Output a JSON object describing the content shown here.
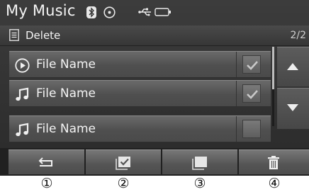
{
  "header": {
    "title": "My Music",
    "icons": [
      "bluetooth-icon",
      "disc-icon",
      "usb-icon",
      "ipod-icon"
    ]
  },
  "subheader": {
    "menu_icon": "list-menu-icon",
    "label": "Delete",
    "page_indicator": "2/2"
  },
  "list": {
    "items": [
      {
        "name": "File Name",
        "icon": "play-circle-icon",
        "checked": true
      },
      {
        "name": "File Name",
        "icon": "music-note-icon",
        "checked": true
      },
      {
        "name": "File Name",
        "icon": "music-note-icon",
        "checked": false
      }
    ]
  },
  "scroll": {
    "up_icon": "triangle-up-icon",
    "down_icon": "triangle-down-icon"
  },
  "bottom_bar": {
    "buttons": [
      {
        "icon": "back-arrow-icon"
      },
      {
        "icon": "select-all-icon"
      },
      {
        "icon": "deselect-all-icon"
      },
      {
        "icon": "trash-icon"
      }
    ]
  },
  "callouts": [
    "①",
    "②",
    "③",
    "④"
  ],
  "colors": {
    "panel": "#2e2e2e",
    "row": "#595959",
    "text": "#f4f4f4"
  }
}
